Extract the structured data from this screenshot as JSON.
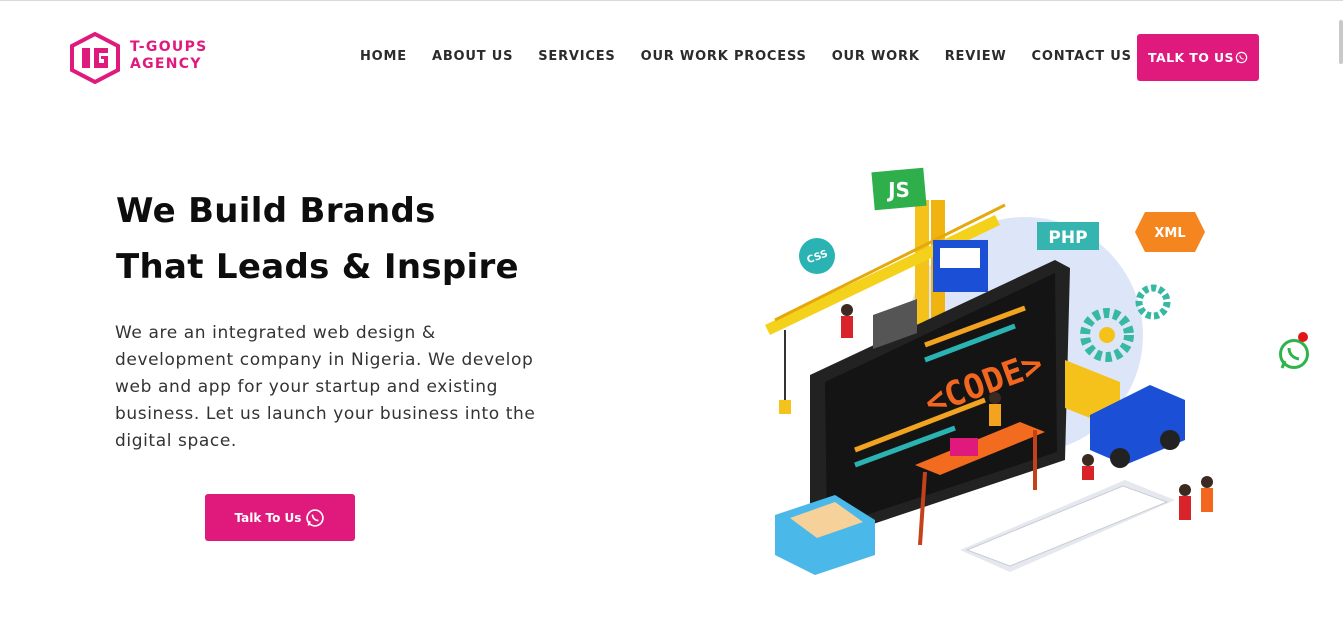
{
  "brand": {
    "line1": "T-GOUPS",
    "line2": "AGENCY",
    "color": "#e0197d"
  },
  "nav": {
    "items": [
      "HOME",
      "ABOUT US",
      "SERVICES",
      "OUR WORK PROCESS",
      "OUR WORK",
      "REVIEW",
      "CONTACT US"
    ],
    "cta_label": "TALK TO US"
  },
  "hero": {
    "headline_line1": "We Build Brands",
    "headline_line2": "That Leads & Inspire",
    "description": "We are an integrated web design & development company in Nigeria. We develop web and app for your startup and existing business. Let us launch your business into the digital space.",
    "cta_label": "Talk To Us"
  },
  "illustration": {
    "tags": [
      "JS",
      "CSS",
      "PHP",
      "XML"
    ],
    "screen_text": "<CODE>"
  },
  "icons": {
    "whatsapp": "whatsapp-icon",
    "logo": "logo-icon"
  }
}
